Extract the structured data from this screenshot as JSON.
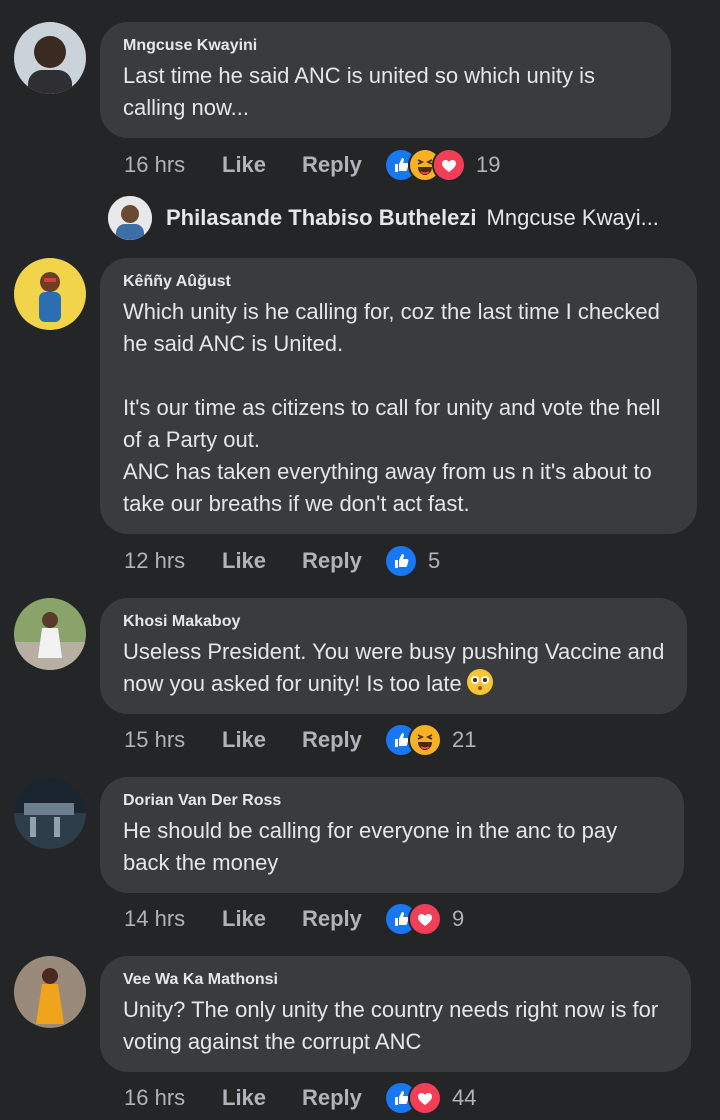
{
  "comments": [
    {
      "name": "Mngcuse Kwayini",
      "text": "Last time he said ANC is united so  which unity is calling now...",
      "time": "16 hrs",
      "like": "Like",
      "reply": "Reply",
      "reactions": [
        "like-icon",
        "laugh-icon",
        "love-icon"
      ],
      "count": "19"
    },
    {
      "name": "Kêññy Aûğust",
      "text": "Which unity is he calling for, coz the last time I checked he said ANC is United.\n\nIt's our time as citizens to call for unity and vote the hell of a Party out.\nANC has taken everything away from us n it's about to take our breaths if we don't act fast.",
      "time": "12 hrs",
      "like": "Like",
      "reply": "Reply",
      "reactions": [
        "like-icon"
      ],
      "count": "5"
    },
    {
      "name": "Khosi Makaboy",
      "text": "Useless President. You were busy pushing Vaccine and now you asked for unity! Is too late",
      "time": "15 hrs",
      "like": "Like",
      "reply": "Reply",
      "reactions": [
        "like-icon",
        "laugh-icon"
      ],
      "count": "21"
    },
    {
      "name": "Dorian Van Der Ross",
      "text": "He should be calling for everyone in the anc to pay back the money",
      "time": "14 hrs",
      "like": "Like",
      "reply": "Reply",
      "reactions": [
        "like-icon",
        "love-icon"
      ],
      "count": "9"
    },
    {
      "name": "Vee Wa Ka Mathonsi",
      "text": "Unity? The only unity the country needs right now is for voting against the corrupt ANC",
      "time": "16 hrs",
      "like": "Like",
      "reply": "Reply",
      "reactions": [
        "like-icon",
        "love-icon"
      ],
      "count": "44"
    }
  ],
  "reply_preview": {
    "name": "Philasande Thabiso Buthelezi",
    "text": "Mngcuse Kwayi..."
  },
  "colors": {
    "background": "#242526",
    "bubble": "#3a3b3c",
    "text": "#e4e6eb",
    "muted": "#b0b3b8",
    "like_blue": "#1877f2",
    "love_red": "#f33e58",
    "haha_yellow": "#f7b125"
  }
}
